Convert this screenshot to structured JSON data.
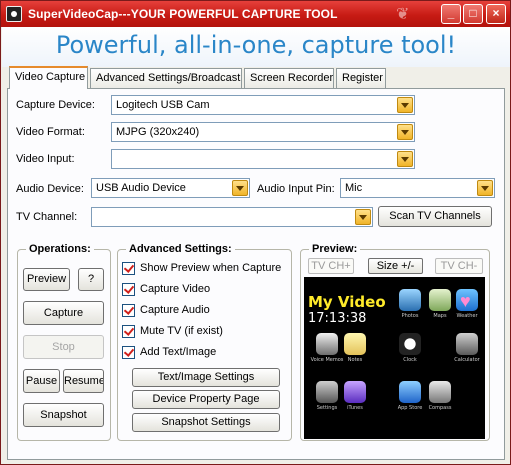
{
  "window": {
    "title": "SuperVideoCap---YOUR POWERFUL CAPTURE TOOL",
    "minimize": "_",
    "maximize": "□",
    "close": "×"
  },
  "banner": "Powerful, all-in-one, capture tool!",
  "tabs": [
    {
      "label": "Video Capture",
      "active": true
    },
    {
      "label": "Advanced Settings/Broadcast"
    },
    {
      "label": "Screen Recorder"
    },
    {
      "label": "Register"
    }
  ],
  "fields": {
    "capture_device": {
      "label": "Capture Device:",
      "value": "Logitech USB Cam"
    },
    "video_format": {
      "label": "Video Format:",
      "value": "MJPG (320x240)"
    },
    "video_input": {
      "label": "Video Input:",
      "value": ""
    },
    "audio_device": {
      "label": "Audio Device:",
      "value": "USB Audio Device"
    },
    "audio_input_pin": {
      "label": "Audio Input Pin:",
      "value": "Mic"
    },
    "tv_channel": {
      "label": "TV Channel:",
      "value": ""
    },
    "scan_tv_channels": "Scan TV Channels"
  },
  "operations": {
    "title": "Operations:",
    "preview": "Preview",
    "help": "?",
    "capture": "Capture",
    "stop": "Stop",
    "pause": "Pause",
    "resume": "Resume",
    "snapshot": "Snapshot"
  },
  "advanced": {
    "title": "Advanced Settings:",
    "checks": [
      {
        "label": "Show Preview when Capture",
        "checked": true
      },
      {
        "label": "Capture Video",
        "checked": true
      },
      {
        "label": "Capture Audio",
        "checked": true
      },
      {
        "label": "Mute TV (if exist)",
        "checked": true
      },
      {
        "label": "Add Text/Image",
        "checked": true
      }
    ],
    "text_image_settings": "Text/Image Settings",
    "device_property_page": "Device Property Page",
    "snapshot_settings": "Snapshot Settings"
  },
  "preview": {
    "title": "Preview:",
    "tv_ch_plus": "TV CH+",
    "size": "Size +/-",
    "tv_ch_minus": "TV CH-",
    "overlay_text": "My Video",
    "overlay_time": "17:13:38",
    "app_labels": [
      "Photos",
      "Maps",
      "Weather",
      "Voice Memos",
      "Notes",
      "Clock",
      "Calculator",
      "Settings",
      "iTunes",
      "App Store",
      "Compass"
    ]
  }
}
